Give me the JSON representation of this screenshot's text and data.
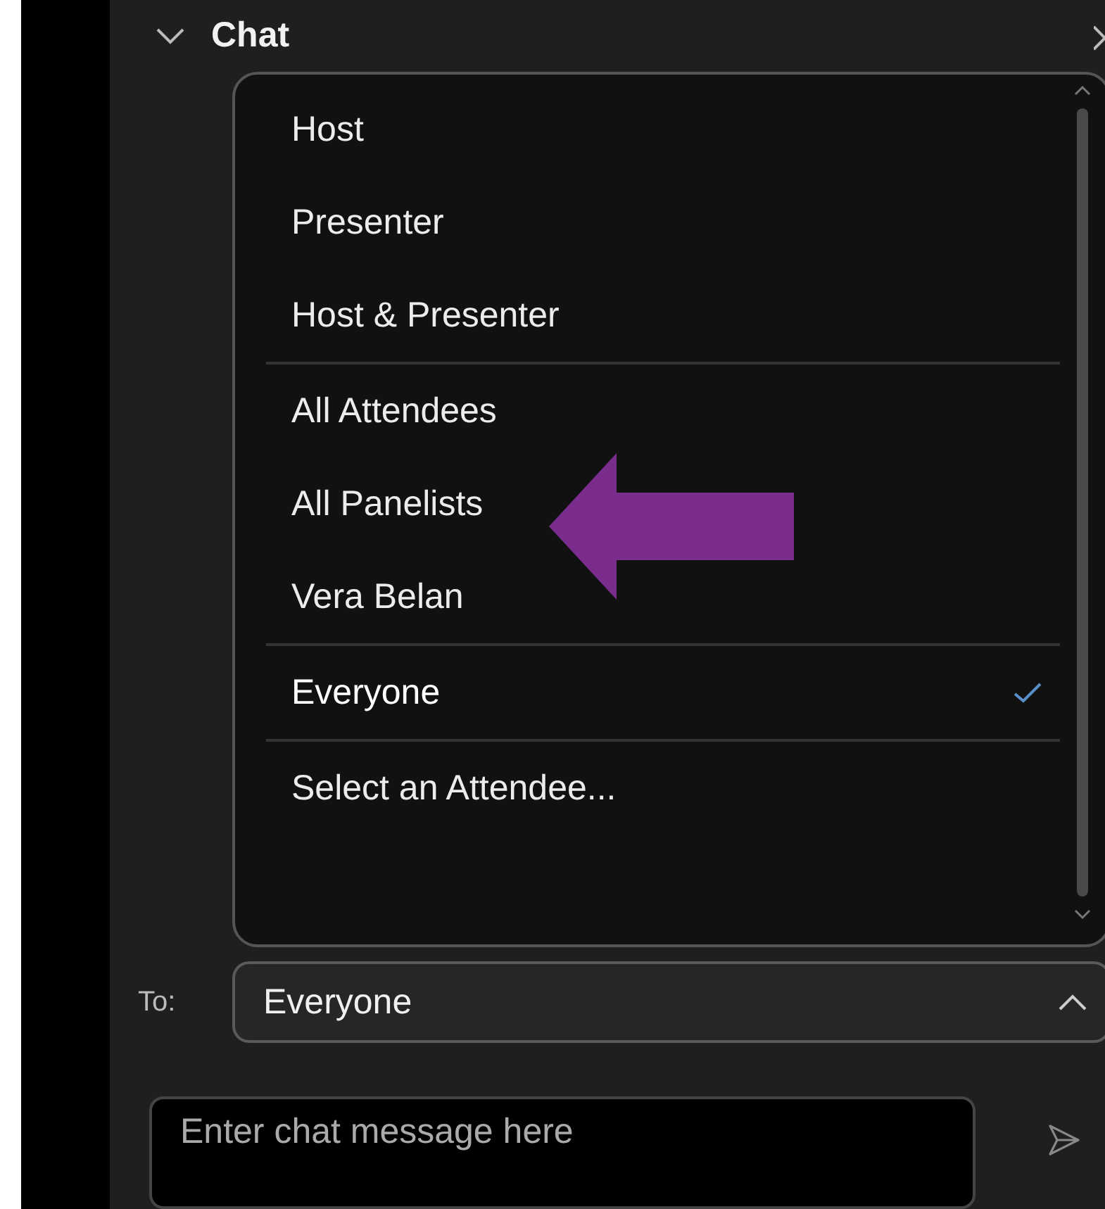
{
  "panel": {
    "title": "Chat",
    "expanded": true
  },
  "menu": {
    "groups": [
      [
        {
          "label": "Host",
          "selected": false
        },
        {
          "label": "Presenter",
          "selected": false
        },
        {
          "label": "Host & Presenter",
          "selected": false
        }
      ],
      [
        {
          "label": "All Attendees",
          "selected": false
        },
        {
          "label": "All Panelists",
          "selected": false
        },
        {
          "label": "Vera Belan",
          "selected": false
        }
      ],
      [
        {
          "label": "Everyone",
          "selected": true
        }
      ],
      [
        {
          "label": "Select an Attendee...",
          "selected": false
        }
      ]
    ]
  },
  "recipient": {
    "label": "To:",
    "value": "Everyone"
  },
  "message": {
    "placeholder": "Enter chat message here"
  }
}
